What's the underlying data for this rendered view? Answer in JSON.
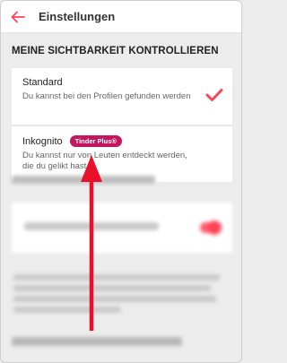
{
  "header": {
    "title": "Einstellungen",
    "back_icon": "arrow-left-icon"
  },
  "section": {
    "heading": "MEINE SICHTBARKEIT KONTROLLIEREN"
  },
  "options": [
    {
      "title": "Standard",
      "description": "Du kannst bei den Profilen gefunden werden",
      "selected": true
    },
    {
      "title": "Inkognito",
      "badge": "Tinder Plus®",
      "description": "Du kannst nur von Leuten entdeckt werden, die du gelikt hast",
      "selected": false
    }
  ],
  "colors": {
    "accent": "#ff4458",
    "badge": "#c4165f",
    "annotation_arrow": "#e8102a"
  }
}
